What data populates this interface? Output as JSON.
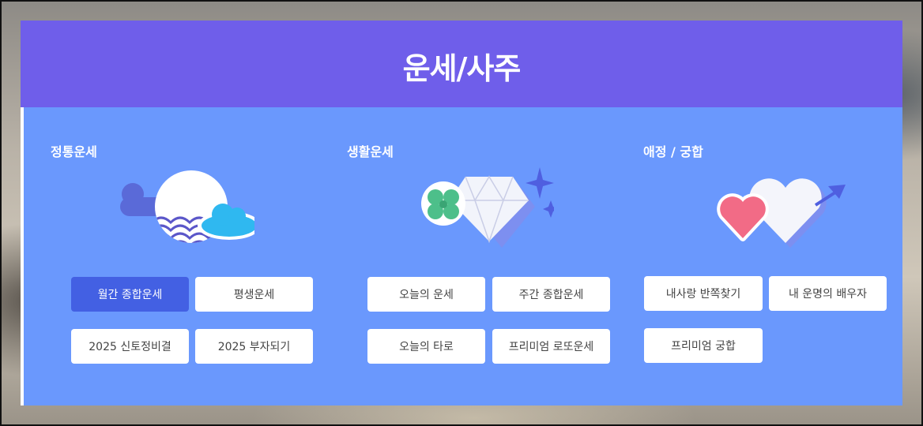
{
  "page": {
    "title": "운세/사주",
    "colors": {
      "header_bg": "#6f5eea",
      "panel_bg": "#6a98fd",
      "active_button": "#4360e3",
      "button_bg": "#ffffff"
    }
  },
  "categories": [
    {
      "title": "정통운세",
      "icon": "moon-cloud-icon",
      "buttons": [
        {
          "label": "월간 종합운세",
          "active": true
        },
        {
          "label": "평생운세",
          "active": false
        },
        {
          "label": "2025 신토정비결",
          "active": false
        },
        {
          "label": "2025 부자되기",
          "active": false
        }
      ]
    },
    {
      "title": "생활운세",
      "icon": "diamond-clover-icon",
      "buttons": [
        {
          "label": "오늘의 운세",
          "active": false
        },
        {
          "label": "주간 종합운세",
          "active": false
        },
        {
          "label": "오늘의 타로",
          "active": false
        },
        {
          "label": "프리미엄 로또운세",
          "active": false
        }
      ]
    },
    {
      "title": "애정 / 궁합",
      "icon": "hearts-arrow-icon",
      "buttons": [
        {
          "label": "내사랑 반쪽찾기",
          "active": false
        },
        {
          "label": "내 운명의 배우자",
          "active": false
        },
        {
          "label": "프리미엄 궁합",
          "active": false
        }
      ]
    }
  ]
}
